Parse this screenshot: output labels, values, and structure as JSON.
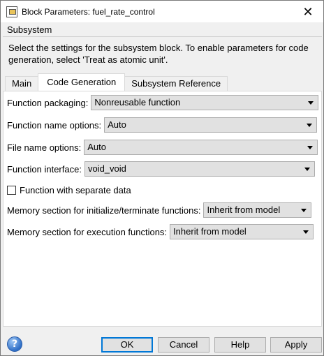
{
  "window": {
    "title": "Block Parameters: fuel_rate_control",
    "icon": "block-parameters-icon",
    "close_glyph": "✕"
  },
  "section": {
    "heading": "Subsystem",
    "description": "Select the settings for the subsystem block. To enable parameters for code generation, select 'Treat as atomic unit'."
  },
  "tabs": [
    {
      "label": "Main",
      "active": false
    },
    {
      "label": "Code Generation",
      "active": true
    },
    {
      "label": "Subsystem Reference",
      "active": false
    }
  ],
  "fields": {
    "function_packaging": {
      "label": "Function packaging:",
      "value": "Nonreusable function"
    },
    "function_name_options": {
      "label": "Function name options:",
      "value": "Auto"
    },
    "file_name_options": {
      "label": "File name options:",
      "value": "Auto"
    },
    "function_interface": {
      "label": "Function interface:",
      "value": "void_void"
    },
    "separate_data": {
      "label": "Function with separate data",
      "checked": false
    },
    "memory_init_term": {
      "label": "Memory section for initialize/terminate functions:",
      "value": "Inherit from model"
    },
    "memory_exec": {
      "label": "Memory section for execution functions:",
      "value": "Inherit from model"
    }
  },
  "footer": {
    "help_icon_glyph": "?",
    "ok_label": "OK",
    "cancel_label": "Cancel",
    "help_label": "Help",
    "apply_label": "Apply"
  }
}
